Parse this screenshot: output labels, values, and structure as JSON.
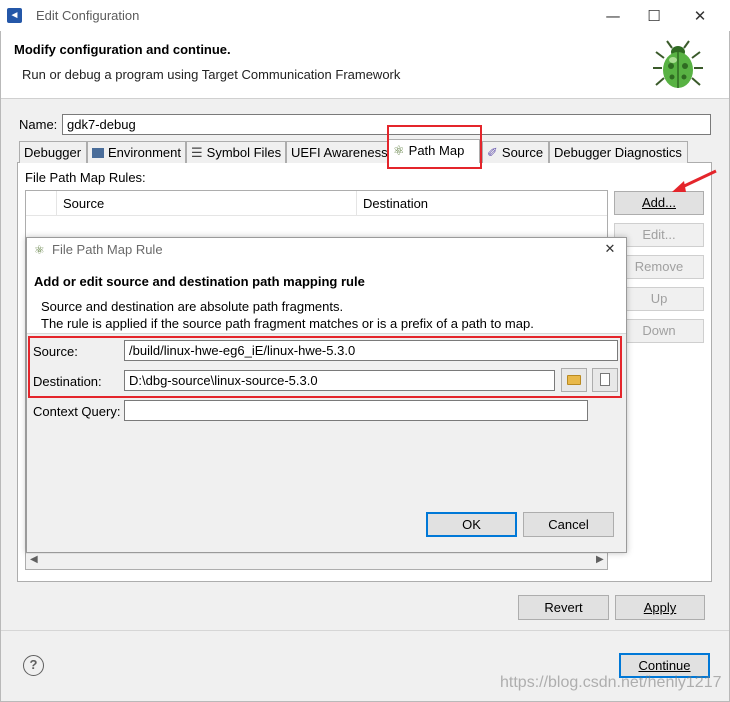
{
  "window": {
    "title": "Edit Configuration",
    "minimize_glyph": "—",
    "maximize_glyph": "☐",
    "close_glyph": "✕"
  },
  "header": {
    "title": "Modify configuration and continue.",
    "description": "Run or debug a program using Target Communication Framework"
  },
  "name_field": {
    "label": "Name:",
    "value": "gdk7-debug"
  },
  "tabs": [
    {
      "label": "Debugger",
      "icon": "none"
    },
    {
      "label": "Environment",
      "icon": "environment-icon"
    },
    {
      "label": "Symbol Files",
      "icon": "symbol-files-icon"
    },
    {
      "label": "UEFI Awareness",
      "icon": "none"
    },
    {
      "label": "Path Map",
      "icon": "path-map-icon"
    },
    {
      "label": "Source",
      "icon": "source-icon"
    },
    {
      "label": "Debugger Diagnostics",
      "icon": "none"
    }
  ],
  "active_tab": "Path Map",
  "path_map": {
    "rules_label": "File Path Map Rules:",
    "columns": [
      "Source",
      "Destination"
    ],
    "buttons": {
      "add": "Add...",
      "edit": "Edit...",
      "remove": "Remove",
      "up": "Up",
      "down": "Down"
    }
  },
  "footer": {
    "revert": "Revert",
    "apply": "Apply",
    "continue": "Continue",
    "help_glyph": "?"
  },
  "dialog": {
    "title": "File Path Map Rule",
    "close_glyph": "✕",
    "heading": "Add or edit source and destination path mapping rule",
    "desc_line1": "Source and destination are absolute path fragments.",
    "desc_line2": "The rule is applied if the source path fragment matches or is a prefix of a path to map.",
    "source_label": "Source:",
    "source_value": "/build/linux-hwe-eg6_iE/linux-hwe-5.3.0",
    "destination_label": "Destination:",
    "destination_value": "D:\\dbg-source\\linux-source-5.3.0",
    "context_label": "Context Query:",
    "context_value": "",
    "ok": "OK",
    "cancel": "Cancel"
  },
  "watermark": "https://blog.csdn.net/henly1217",
  "colors": {
    "highlight": "#e4252b",
    "accent": "#0078d7"
  }
}
